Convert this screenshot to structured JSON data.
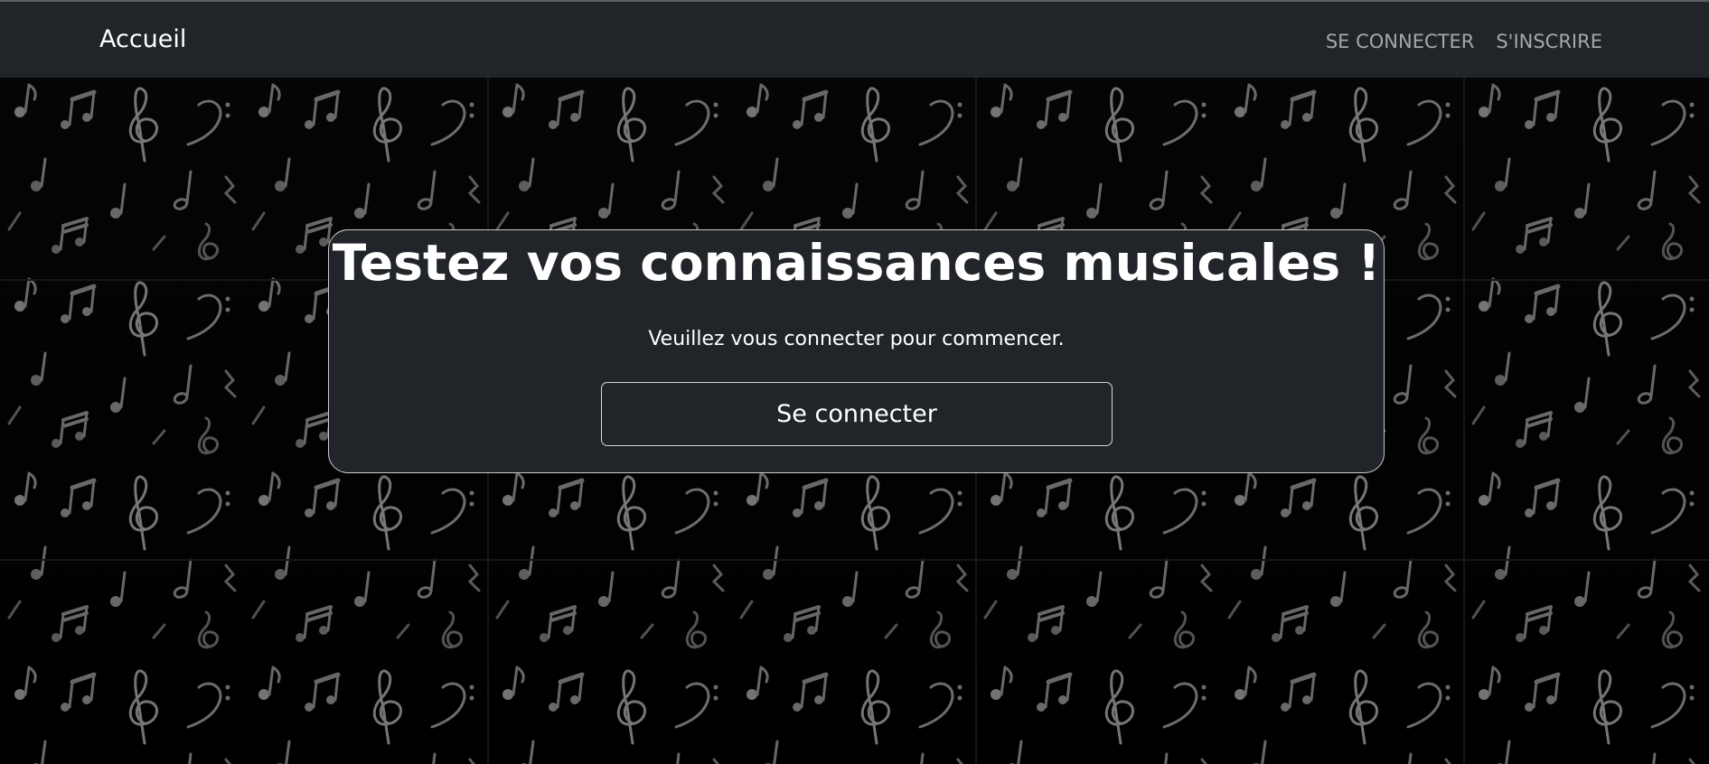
{
  "navbar": {
    "brand": "Accueil",
    "links": [
      "SE CONNECTER",
      "S'INSCRIRE"
    ]
  },
  "hero": {
    "title": "Testez vos connaissances musicales !",
    "subtitle": "Veuillez vous connecter pour commencer.",
    "button_label": "Se connecter"
  },
  "colors": {
    "navbar_bg": "#212529",
    "card_bg": "#212529",
    "page_bg": "#040404",
    "link": "#a4a8ad"
  },
  "background": {
    "pattern": "music-notes-icon"
  }
}
